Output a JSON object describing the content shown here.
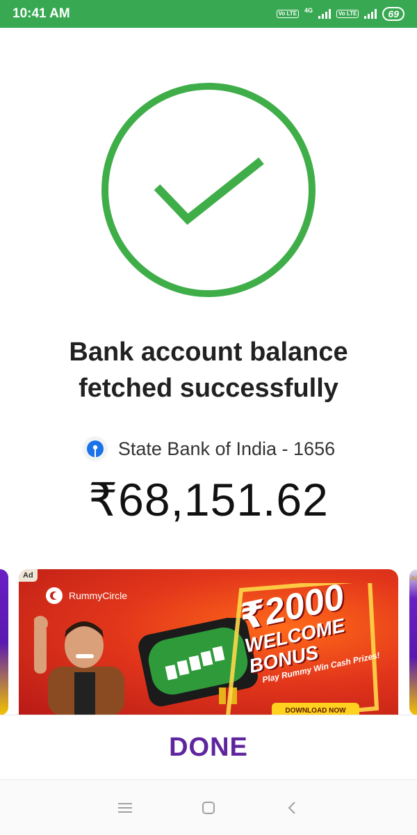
{
  "status_bar": {
    "time": "10:41 AM",
    "sim1_label": "Vo LTE",
    "network_type": "4G",
    "sim2_label": "Vo LTE",
    "battery": "69"
  },
  "result": {
    "icon": "check-circle-icon",
    "title_line1": "Bank account balance",
    "title_line2": "fetched successfully"
  },
  "account": {
    "bank_icon": "sbi-logo-icon",
    "label": "State Bank of India - 1656",
    "balance": "₹68,151.62"
  },
  "ad": {
    "tag": "Ad",
    "brand": "RummyCircle",
    "amount": "₹2000",
    "headline_line1": "WELCOME",
    "headline_line2": "BONUS",
    "tagline": "Play Rummy Win Cash Prizes!",
    "cta": "DOWNLOAD NOW",
    "next_tag": "Ad"
  },
  "actions": {
    "done_label": "DONE"
  },
  "nav": {
    "menu_icon": "menu-icon",
    "home_icon": "home-square-icon",
    "back_icon": "back-chevron-icon"
  },
  "colors": {
    "status_bar": "#38a852",
    "success_green": "#3fae49",
    "done_purple": "#5f259f",
    "sbi_blue": "#1a73e8"
  }
}
